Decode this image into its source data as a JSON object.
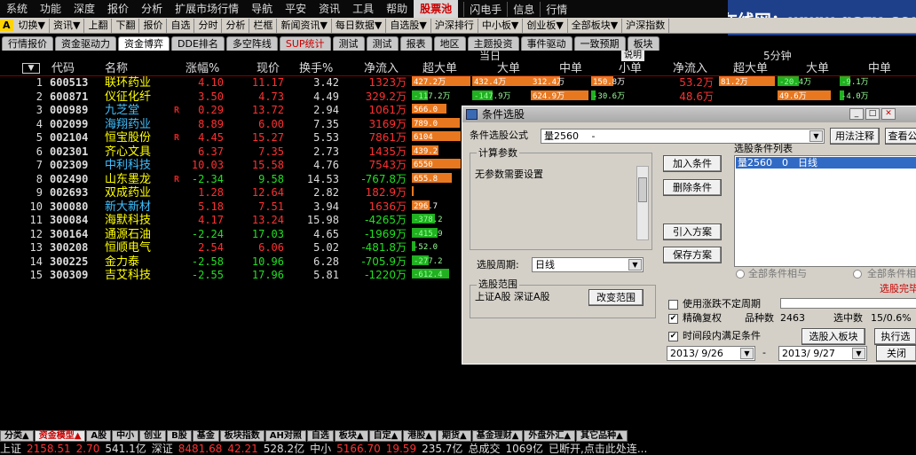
{
  "menubar": {
    "items": [
      "系统",
      "功能",
      "深度",
      "报价",
      "分析",
      "扩展市场行情",
      "导航",
      "平安",
      "资讯",
      "工具",
      "帮助",
      "股票池"
    ],
    "active_index": 11,
    "right_items": [
      "闪电手",
      "信息",
      "行情"
    ]
  },
  "logo_overlay": "公式在线网：www.gszx.com.cn",
  "toolbar": {
    "badge": "A",
    "items": [
      "切换▼",
      "资讯▼",
      "上翻",
      "下翻",
      "报价",
      "自选",
      "分时",
      "分析",
      "栏框",
      "新闻资讯▼",
      "每日数据▼",
      "自选股▼",
      "沪深排行",
      "中小板▼",
      "创业板▼",
      "全部板块▼",
      "沪深指数"
    ]
  },
  "tabs1": [
    "行情报价",
    "资金驱动力",
    "资金博弈",
    "DDE排名",
    "多空阵线",
    "SUP统计",
    "测试",
    "测试",
    "报表",
    "地区",
    "主题投资",
    "事件驱动",
    "一致预期",
    "板块"
  ],
  "tabs1_active": 2,
  "group_header": {
    "today": "当日",
    "desc_btn": "说明",
    "five_min": "5分钟"
  },
  "columns": [
    "代码",
    "名称",
    "涨幅%",
    "现价",
    "换手%",
    "净流入",
    "超大单",
    "大单",
    "中单",
    "小单",
    "净流入",
    "超大单",
    "大单",
    "中单"
  ],
  "rows": [
    {
      "idx": "1",
      "code": "600513",
      "name": "联环药业",
      "r": "",
      "chg": "4.10",
      "price": "11.17",
      "turn": "3.42",
      "net": "1323万",
      "b1": {
        "v": 427.2,
        "t": "427.2万"
      },
      "b2": {
        "v": 432.4,
        "t": "432.4万"
      },
      "b3": {
        "v": 312.4,
        "t": "312.4万"
      },
      "b4": {
        "v": 150.8,
        "t": "150.8万"
      },
      "net5": "53.2万",
      "c1": {
        "v": 81.2,
        "t": "81.2万"
      },
      "c2": {
        "v": -20.4,
        "t": "-20.4万"
      },
      "c3": {
        "v": -9.1,
        "t": "-9.1万"
      }
    },
    {
      "idx": "2",
      "code": "600871",
      "name": "仪征化纤",
      "r": "",
      "chg": "3.50",
      "price": "4.73",
      "turn": "4.49",
      "net": "329.2万",
      "b1": {
        "v": -117.2,
        "t": "-117.2万"
      },
      "b2": {
        "v": -147.9,
        "t": "-147.9万"
      },
      "b3": {
        "v": 624.9,
        "t": "624.9万"
      },
      "b4": {
        "v": -30.6,
        "t": "-30.6万"
      },
      "net5": "48.6万",
      "c1": {
        "v": 0,
        "t": ""
      },
      "c2": {
        "v": 49.6,
        "t": "49.6万"
      },
      "c3": {
        "v": -4.0,
        "t": "-4.0万"
      }
    },
    {
      "idx": "3",
      "code": "000989",
      "name": "九芝堂",
      "r": "R",
      "chg": "0.29",
      "price": "13.72",
      "turn": "2.94",
      "net": "1061万",
      "b1": {
        "v": 566.0,
        "t": "566.0"
      }
    },
    {
      "idx": "4",
      "code": "002099",
      "name": "海翔药业",
      "r": "",
      "chg": "8.89",
      "price": "6.00",
      "turn": "7.35",
      "net": "3169万",
      "b1": {
        "v": 789.0,
        "t": "789.0"
      }
    },
    {
      "idx": "5",
      "code": "002104",
      "name": "恒宝股份",
      "r": "R",
      "chg": "4.45",
      "price": "15.27",
      "turn": "5.53",
      "net": "7861万",
      "b1": {
        "v": 6104,
        "t": "6104"
      }
    },
    {
      "idx": "6",
      "code": "002301",
      "name": "齐心文具",
      "r": "",
      "chg": "6.37",
      "price": "7.35",
      "turn": "2.73",
      "net": "1435万",
      "b1": {
        "v": 439.2,
        "t": "439.2"
      }
    },
    {
      "idx": "7",
      "code": "002309",
      "name": "中利科技",
      "r": "",
      "chg": "10.03",
      "price": "15.58",
      "turn": "4.76",
      "net": "7543万",
      "b1": {
        "v": 6550,
        "t": "6550"
      }
    },
    {
      "idx": "8",
      "code": "002490",
      "name": "山东墨龙",
      "r": "R",
      "chg": "-2.34",
      "price": "9.58",
      "turn": "14.53",
      "net": "-767.8万",
      "b1": {
        "v": 655.8,
        "t": "655.8"
      }
    },
    {
      "idx": "9",
      "code": "002693",
      "name": "双成药业",
      "r": "",
      "chg": "1.28",
      "price": "12.64",
      "turn": "2.82",
      "net": "182.9万",
      "b1": {
        "v": 5,
        "t": ""
      }
    },
    {
      "idx": "10",
      "code": "300080",
      "name": "新大新材",
      "r": "",
      "chg": "5.18",
      "price": "7.51",
      "turn": "3.94",
      "net": "1636万",
      "b1": {
        "v": 296.7,
        "t": "296.7"
      }
    },
    {
      "idx": "11",
      "code": "300084",
      "name": "海默科技",
      "r": "",
      "chg": "4.17",
      "price": "13.24",
      "turn": "15.98",
      "net": "-4265万",
      "b1": {
        "v": -378.2,
        "t": "-378.2"
      }
    },
    {
      "idx": "12",
      "code": "300164",
      "name": "通源石油",
      "r": "",
      "chg": "-2.24",
      "price": "17.03",
      "turn": "4.65",
      "net": "-1969万",
      "b1": {
        "v": -415.9,
        "t": "-415.9"
      }
    },
    {
      "idx": "13",
      "code": "300208",
      "name": "恒顺电气",
      "r": "",
      "chg": "2.54",
      "price": "6.06",
      "turn": "5.02",
      "net": "-481.8万",
      "b1": {
        "v": -52.0,
        "t": "-52.0"
      }
    },
    {
      "idx": "14",
      "code": "300225",
      "name": "金力泰",
      "r": "",
      "chg": "-2.58",
      "price": "10.96",
      "turn": "6.28",
      "net": "-705.9万",
      "b1": {
        "v": -277.2,
        "t": "-277.2"
      }
    },
    {
      "idx": "15",
      "code": "300309",
      "name": "吉艾科技",
      "r": "",
      "chg": "-2.55",
      "price": "17.96",
      "turn": "5.81",
      "net": "-1220万",
      "b1": {
        "v": -612.4,
        "t": "-612.4"
      }
    }
  ],
  "dialog": {
    "title": "条件选股",
    "formula_label": "条件选股公式",
    "formula_value": "量2560　 -",
    "usage_btn": "用法注释",
    "view_btn": "查看公",
    "params_group": "计算参数",
    "no_params": "无参数需要设置",
    "add_btn": "加入条件",
    "del_btn": "删除条件",
    "import_btn": "引入方案",
    "save_btn": "保存方案",
    "list_label": "选股条件列表",
    "list_item": "量2560　0　日线",
    "period_label": "选股周期:",
    "period_value": "日线",
    "radio_and": "全部条件相与",
    "radio_or": "全部条件相",
    "finish_text": "选股完毕",
    "range_group": "选股范围",
    "range_value": "上证A股 深证A股",
    "change_range_btn": "改变范围",
    "unfixed_period": "使用涨跌不定周期",
    "exact_restore": "精确复权",
    "count_label": "品种数",
    "count_value": "2463",
    "selected_label": "选中数",
    "selected_value": "15/0.6%",
    "period_in": "时间段内满足条件",
    "to_block_btn": "选股入板块",
    "exec_btn": "执行选",
    "start_date": "2013/ 9/26",
    "end_date": "2013/ 9/27",
    "close_btn": "关闭"
  },
  "tabs2": [
    "分类▲",
    "资金模型▲",
    "A股",
    "中小",
    "创业",
    "B股",
    "基金",
    "板块指数",
    "AH对照",
    "自选",
    "板块▲",
    "自定▲",
    "港股▲",
    "期货▲",
    "基金理财▲",
    "外盘外汇▲",
    "其它品种▲"
  ],
  "tabs2_active": 1,
  "status": {
    "sh_label": "上证",
    "sh_val": "2158.51",
    "sh_chg": "2.70",
    "sh_amt": "541.1亿",
    "sz_label": "深证",
    "sz_val": "8481.68",
    "sz_chg": "42.21",
    "sz_amt": "528.2亿",
    "zx_label": "中小",
    "zx_val": "5166.70",
    "zx_chg": "19.59",
    "zx_amt": "235.7亿",
    "total_label": "总成交",
    "total_val": "1069亿",
    "msg": "已断开,点击此处连..."
  },
  "colors": {
    "up": "#ff3030",
    "down": "#20e020",
    "name": "#ffff00",
    "name_alt": "#40c0ff",
    "bar_up": "#e87820",
    "bar_down": "#20b020",
    "code": "#ddd"
  }
}
